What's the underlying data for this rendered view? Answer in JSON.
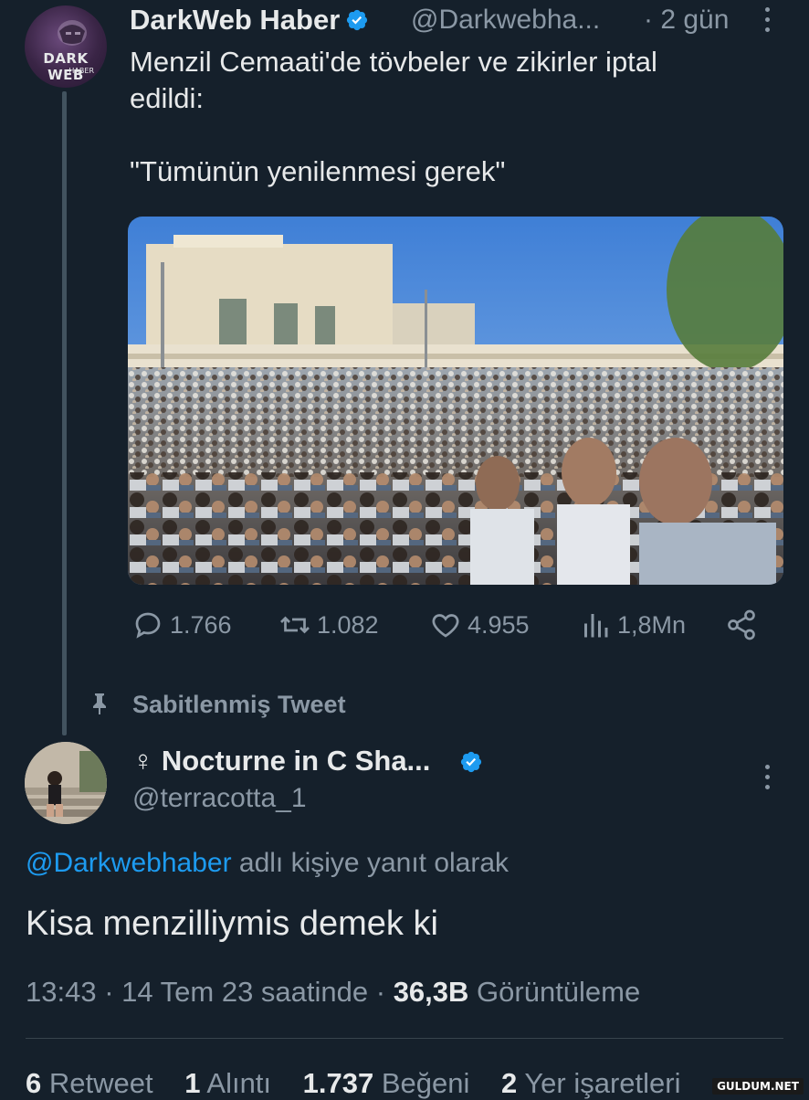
{
  "tweet1": {
    "avatar_logo_top": "DARK WEB",
    "avatar_logo_bottom": "HABER",
    "name": "DarkWeb Haber",
    "handle": "@Darkwebha...",
    "time": "· 2 gün",
    "text": "Menzil Cemaati'de tövbeler ve zikirler iptal\nedildi:\n\n\"Tümünün yenilenmesi gerek\"",
    "actions": {
      "replies": "1.766",
      "retweets": "1.082",
      "likes": "4.955",
      "views": "1,8Mn"
    },
    "icons": [
      "reply-icon",
      "retweet-icon",
      "like-icon",
      "views-icon",
      "share-icon"
    ]
  },
  "pinned": {
    "label": "Sabitlenmiş Tweet"
  },
  "tweet2": {
    "name": "♀ Nocturne in C Sha...",
    "handle": "@terracotta_1",
    "reply_link": "@Darkwebhaber",
    "reply_suffix": " adlı kişiye yanıt olarak",
    "text": "Kisa menzilliymis demek ki",
    "time": "13:43 · 14 Tem 23 saatinde · ",
    "views_count": "36,3B",
    "views_label": " Görüntüleme",
    "stats": {
      "retweet_count": "6",
      "retweet_label": "Retweet",
      "quote_count": "1",
      "quote_label": "Alıntı",
      "like_count": "1.737",
      "like_label": "Beğeni",
      "bookmark_count": "2",
      "bookmark_label": "Yer işaretleri"
    }
  },
  "watermark": "GULDUM.NET",
  "colors": {
    "background": "#15202b",
    "text": "#e7e9ea",
    "muted": "#8b98a5",
    "link": "#1d9bf0",
    "verified": "#1d9bf0"
  }
}
